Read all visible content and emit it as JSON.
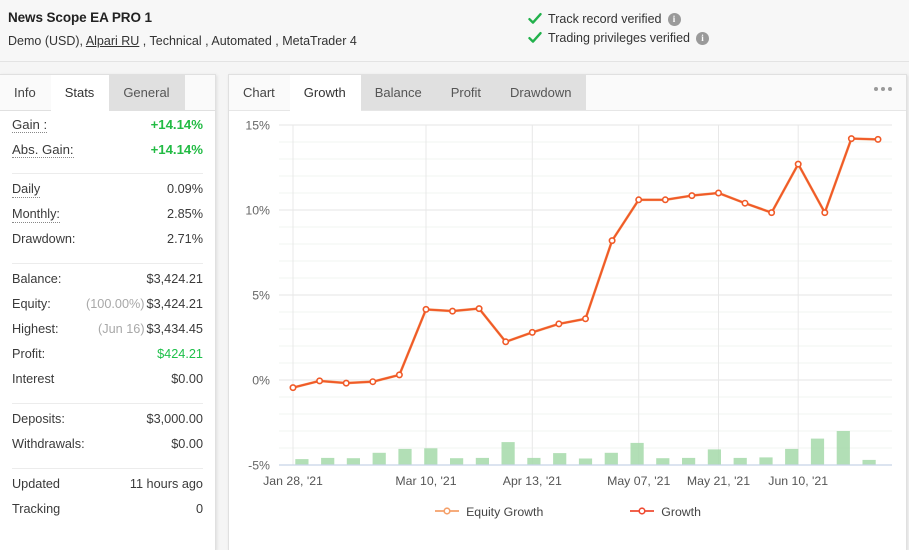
{
  "header": {
    "account_title": "News Scope EA PRO 1",
    "account_meta_prefix": "Demo (USD),",
    "broker": "Alpari RU",
    "account_meta_suffix": ", Technical , Automated , MetaTrader 4",
    "verifications": [
      {
        "label": "Track record verified",
        "info": "i"
      },
      {
        "label": "Trading privileges verified",
        "info": "i"
      }
    ],
    "check_color": "#22b14c"
  },
  "left_panel": {
    "tabs": [
      {
        "label": "Info",
        "state": "plain"
      },
      {
        "label": "Stats",
        "state": "active"
      },
      {
        "label": "General",
        "state": "grey"
      }
    ],
    "groups": [
      {
        "rows": [
          {
            "label": "Gain :",
            "underline": "dotted",
            "value": "+14.14%",
            "value_style": "green",
            "emphasis": "big"
          },
          {
            "label": "Abs. Gain:",
            "underline": "dotted",
            "value": "+14.14%",
            "value_style": "green",
            "emphasis": "big"
          }
        ]
      },
      {
        "rows": [
          {
            "label": "Daily",
            "underline": "dotted",
            "value": "0.09%",
            "value_style": ""
          },
          {
            "label": "Monthly:",
            "underline": "dotted",
            "value": "2.85%",
            "value_style": ""
          },
          {
            "label": "Drawdown:",
            "underline": "none",
            "value": "2.71%",
            "value_style": ""
          }
        ]
      },
      {
        "rows": [
          {
            "label": "Balance:",
            "underline": "none",
            "value": "$3,424.21",
            "value_style": ""
          },
          {
            "label": "Equity:",
            "underline": "none",
            "prefix": "(100.00%)",
            "value": "$3,424.21",
            "value_style": ""
          },
          {
            "label": "Highest:",
            "underline": "none",
            "prefix": "(Jun 16)",
            "value": "$3,434.45",
            "value_style": ""
          },
          {
            "label": "Profit:",
            "underline": "none",
            "value": "$424.21",
            "value_style": "green-plain"
          },
          {
            "label": "Interest",
            "underline": "none",
            "value": "$0.00",
            "value_style": ""
          }
        ]
      },
      {
        "rows": [
          {
            "label": "Deposits:",
            "underline": "none",
            "value": "$3,000.00",
            "value_style": ""
          },
          {
            "label": "Withdrawals:",
            "underline": "none",
            "value": "$0.00",
            "value_style": ""
          }
        ]
      },
      {
        "rows": [
          {
            "label": "Updated",
            "underline": "none",
            "value": "11 hours ago",
            "value_style": ""
          },
          {
            "label": "Tracking",
            "underline": "none",
            "value": "0",
            "value_style": ""
          }
        ]
      }
    ]
  },
  "chart_panel": {
    "tabs": [
      {
        "label": "Chart",
        "state": "plain"
      },
      {
        "label": "Growth",
        "state": "active"
      },
      {
        "label": "Balance",
        "state": "grey"
      },
      {
        "label": "Profit",
        "state": "grey"
      },
      {
        "label": "Drawdown",
        "state": "grey"
      }
    ],
    "menu_icon": "kebab-menu-icon"
  },
  "chart_data": {
    "type": "line",
    "title": "Growth",
    "xlabel": "",
    "ylabel": "",
    "ylim": [
      -5,
      15
    ],
    "yticks": [
      -5,
      0,
      5,
      10,
      15
    ],
    "ytick_labels": [
      "-5%",
      "0%",
      "5%",
      "10%",
      "15%"
    ],
    "grid": true,
    "legend_position": "bottom",
    "x": [
      "Jan 28, '21",
      "Feb 04, '21",
      "Feb 11, '21",
      "Feb 18, '21",
      "Feb 25, '21",
      "Mar 10, '21",
      "Mar 17, '21",
      "Mar 24, '21",
      "Apr 06, '21",
      "Apr 13, '21",
      "Apr 20, '21",
      "Apr 27, '21",
      "May 03, '21",
      "May 07, '21",
      "May 11, '21",
      "May 17, '21",
      "May 21, '21",
      "May 28, '21",
      "Jun 03, '21",
      "Jun 10, '21",
      "Jun 16, '21"
    ],
    "xtick_labels": [
      "Jan 28, '21",
      "Mar 10, '21",
      "Apr 13, '21",
      "May 07, '21",
      "May 21, '21",
      "Jun 10, '21"
    ],
    "xtick_indices": [
      0,
      5,
      9,
      13,
      16,
      19
    ],
    "series": [
      {
        "name": "Growth",
        "color": "#f05a28",
        "type": "line",
        "values": [
          -0.45,
          -0.05,
          -0.18,
          -0.1,
          0.3,
          4.15,
          4.05,
          4.2,
          2.25,
          2.8,
          3.3,
          3.6,
          8.2,
          10.6,
          10.6,
          10.85,
          11.0,
          10.4,
          9.85,
          12.7,
          9.85
        ]
      },
      {
        "name": "Equity Growth",
        "color": "#f5a06a",
        "type": "line",
        "values": [
          -0.45,
          -0.05,
          -0.18,
          -0.1,
          0.3,
          4.15,
          4.05,
          4.2,
          2.25,
          2.8,
          3.3,
          3.6,
          8.2,
          10.6,
          10.6,
          10.85,
          11.0,
          10.4,
          9.85,
          12.7,
          9.85
        ]
      },
      {
        "name": "Monthly Bars",
        "color": "#a5d9a9",
        "type": "bar",
        "values": [
          0.35,
          0.42,
          0.4,
          0.72,
          0.95,
          0.98,
          0.4,
          0.42,
          1.35,
          0.42,
          0.7,
          0.38,
          0.72,
          1.3,
          0.4,
          0.42,
          0.92,
          0.42,
          0.45,
          0.95,
          1.55,
          2.0,
          0.3
        ]
      }
    ],
    "extra_line_points": [
      14.2,
      14.15
    ],
    "legend": [
      {
        "label": "Equity Growth",
        "color": "#f5a06a"
      },
      {
        "label": "Growth",
        "color": "#ef4b33"
      }
    ]
  }
}
